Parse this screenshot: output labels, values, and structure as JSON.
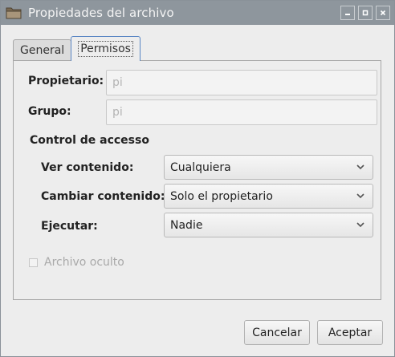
{
  "window": {
    "title": "Propiedades del archivo",
    "icon": "folder-icon",
    "controls": [
      "minimize-icon",
      "maximize-icon",
      "close-icon"
    ]
  },
  "tabs": [
    {
      "label": "General",
      "active": false
    },
    {
      "label": "Permisos",
      "active": true
    }
  ],
  "owner": {
    "label": "Propietario:",
    "value": "pi"
  },
  "group": {
    "label": "Grupo:",
    "value": "pi"
  },
  "access": {
    "heading": "Control de accesso",
    "view": {
      "label": "Ver contenido:",
      "value": "Cualquiera"
    },
    "change": {
      "label": "Cambiar contenido:",
      "value": "Solo el propietario"
    },
    "execute": {
      "label": "Ejecutar:",
      "value": "Nadie"
    }
  },
  "hidden_file": {
    "label": "Archivo oculto",
    "checked": false,
    "enabled": false
  },
  "buttons": {
    "cancel": "Cancelar",
    "accept": "Aceptar"
  },
  "colors": {
    "titlebar": "#8e969d",
    "active_tab_border": "#5b87c4"
  }
}
